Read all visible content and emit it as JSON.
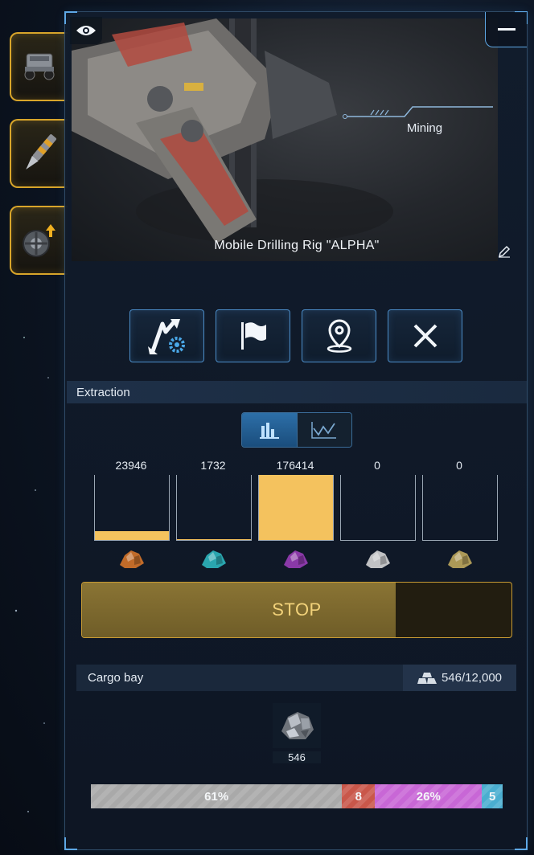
{
  "unit": {
    "name": "Mobile Drilling Rig \"ALPHA\"",
    "status": "Mining"
  },
  "side_tabs": [
    {
      "icon": "rover-icon",
      "active": true
    },
    {
      "icon": "drill-icon",
      "active": true
    },
    {
      "icon": "wheel-upgrade-icon",
      "active": true
    }
  ],
  "actions": [
    {
      "icon": "transfer-settings-icon"
    },
    {
      "icon": "flag-icon"
    },
    {
      "icon": "location-pin-icon"
    },
    {
      "icon": "close-icon"
    }
  ],
  "extraction": {
    "title": "Extraction",
    "view_modes": [
      {
        "icon": "bar-chart-icon",
        "selected": true
      },
      {
        "icon": "line-chart-icon",
        "selected": false
      }
    ],
    "resources": [
      {
        "value": "23946",
        "fill": 0.136,
        "color": "#e07a2a",
        "icon": "orange-ore-icon"
      },
      {
        "value": "1732",
        "fill": 0.01,
        "color": "#2fc0c8",
        "icon": "cyan-crystal-icon"
      },
      {
        "value": "176414",
        "fill": 1.0,
        "color": "#a040c0",
        "icon": "purple-ore-icon"
      },
      {
        "value": "0",
        "fill": 0,
        "color": "#e0e0e0",
        "icon": "white-ore-icon"
      },
      {
        "value": "0",
        "fill": 0,
        "color": "#c8b060",
        "icon": "mixed-crystal-icon"
      }
    ],
    "stop_label": "STOP",
    "stop_progress": 0.73
  },
  "cargo": {
    "title": "Cargo bay",
    "capacity": "546/12,000",
    "item_count": "546",
    "item_icon": "metal-ore-icon",
    "distribution": [
      {
        "label": "61%",
        "share": 0.61,
        "color": "#a9a9a9"
      },
      {
        "label": "8",
        "share": 0.08,
        "color": "#c9574a"
      },
      {
        "label": "26%",
        "share": 0.26,
        "color": "#c867d6"
      },
      {
        "label": "5",
        "share": 0.05,
        "color": "#4aaed0"
      }
    ]
  },
  "colors": {
    "accent": "#5ea8e6",
    "gold": "#d8a52a",
    "bar_fill": "#f4c25e"
  }
}
